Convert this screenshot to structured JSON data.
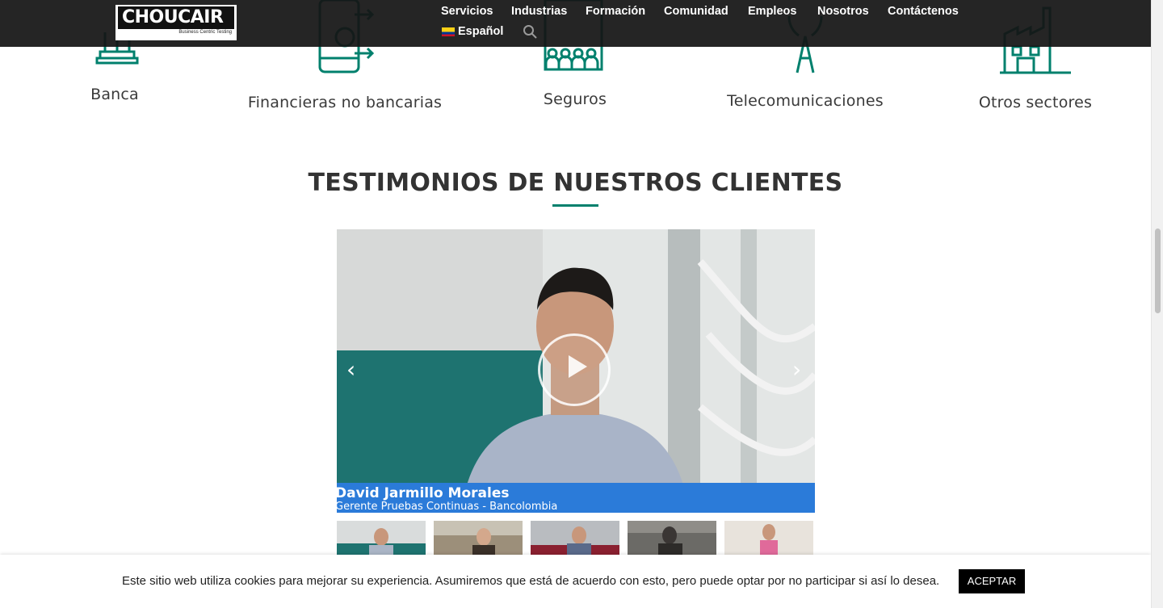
{
  "brand": {
    "name": "CHOUCAIR",
    "tagline": "Business Centric Testing",
    "accent": "#00806d"
  },
  "nav": {
    "items": [
      "Servicios",
      "Industrias",
      "Formación",
      "Comunidad",
      "Empleos",
      "Nosotros",
      "Contáctenos"
    ],
    "language": "Español",
    "search_icon": "search-icon"
  },
  "industries": [
    {
      "label": "Banca",
      "icon": "bank-icon"
    },
    {
      "label": "Financieras no bancarias",
      "icon": "phone-money-icon"
    },
    {
      "label": "Seguros",
      "icon": "building-people-icon"
    },
    {
      "label": "Telecomunicaciones",
      "icon": "antenna-icon"
    },
    {
      "label": "Otros sectores",
      "icon": "factory-icon"
    }
  ],
  "testimonials": {
    "title": "TESTIMONIOS DE NUESTROS CLIENTES",
    "video": {
      "name": "David Jarmillo Morales",
      "role": "Gerente Pruebas Continuas - Bancolombia"
    },
    "prev_icon": "chevron-left-icon",
    "next_icon": "chevron-right-icon",
    "play_icon": "play-icon"
  },
  "cookie": {
    "text": "Este sitio web utiliza cookies para mejorar su experiencia. Asumiremos que está de acuerdo con esto, pero puede optar por no participar si así lo desea.",
    "accept_label": "ACEPTAR"
  }
}
